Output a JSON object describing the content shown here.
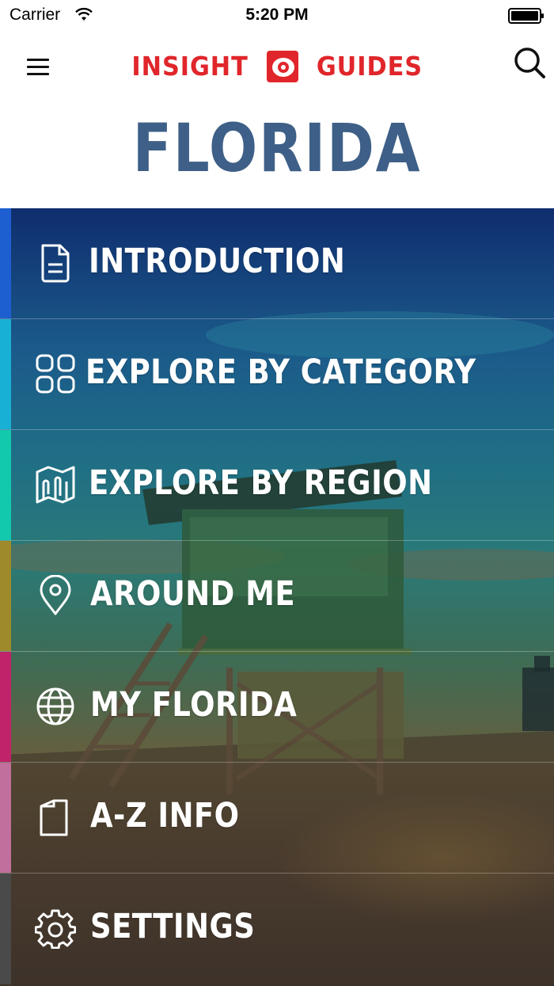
{
  "status_bar": {
    "carrier": "Carrier",
    "time": "5:20 PM",
    "icons": [
      "wifi-icon",
      "battery-icon"
    ]
  },
  "header": {
    "brand_left": "INSIGHT",
    "brand_right": "GUIDES",
    "brand_color": "#e0262b",
    "menu_icon": "hamburger-menu-icon",
    "search_icon": "search-icon"
  },
  "page": {
    "title": "FLORIDA",
    "title_color": "#3e5f87"
  },
  "menu": {
    "items": [
      {
        "label": "INTRODUCTION",
        "icon": "document-icon",
        "stripe_color": "#1d5fd0"
      },
      {
        "label": "EXPLORE BY CATEGORY",
        "icon": "grid-icon",
        "stripe_color": "#19b0d6"
      },
      {
        "label": "EXPLORE BY REGION",
        "icon": "map-icon",
        "stripe_color": "#13c9ad"
      },
      {
        "label": "AROUND ME",
        "icon": "location-pin-icon",
        "stripe_color": "#9e8a2a"
      },
      {
        "label": "MY FLORIDA",
        "icon": "globe-icon",
        "stripe_color": "#c0236a"
      },
      {
        "label": "A-Z INFO",
        "icon": "book-icon",
        "stripe_color": "#c16f9c"
      },
      {
        "label": "SETTINGS",
        "icon": "gear-icon",
        "stripe_color": "#4a4a4a"
      }
    ]
  }
}
